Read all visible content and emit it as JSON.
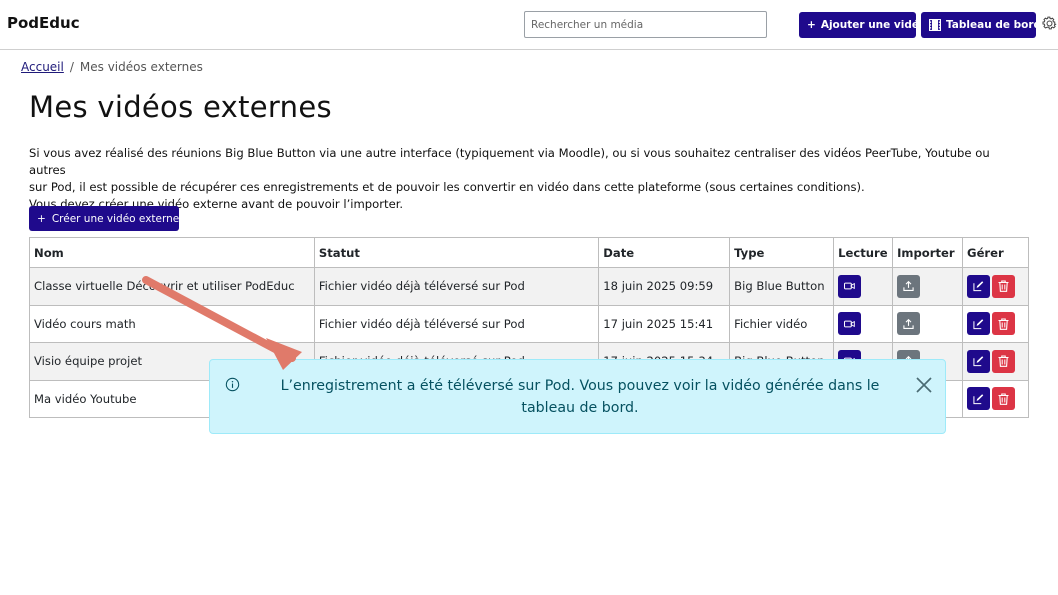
{
  "header": {
    "brand": "PodEduc",
    "search_placeholder": "Rechercher un média",
    "add_video_label": "Ajouter une vidéo",
    "dashboard_label": "Tableau de bord"
  },
  "breadcrumb": {
    "home": "Accueil",
    "separator": "/",
    "current": "Mes vidéos externes"
  },
  "page": {
    "title": "Mes vidéos externes",
    "intro_line1": "Si vous avez réalisé des réunions Big Blue Button via une autre interface (typiquement via Moodle), ou si vous souhaitez centraliser des vidéos PeerTube, Youtube ou autres",
    "intro_line2": "sur Pod, il est possible de récupérer ces enregistrements et de pouvoir les convertir en vidéo dans cette plateforme (sous certaines conditions).",
    "intro_line3": "Vous devez créer une vidéo externe avant de pouvoir l’importer.",
    "create_label": "Créer une vidéo externe"
  },
  "table": {
    "columns": [
      "Nom",
      "Statut",
      "Date",
      "Type",
      "Lecture",
      "Importer",
      "Gérer"
    ],
    "rows": [
      {
        "name": "Classe virtuelle Découvrir et utiliser PodEduc",
        "status": "Fichier vidéo déjà téléversé sur Pod",
        "date": "18 juin 2025 09:59",
        "type": "Big Blue Button"
      },
      {
        "name": "Vidéo cours math",
        "status": "Fichier vidéo déjà téléversé sur Pod",
        "date": "17 juin 2025 15:41",
        "type": "Fichier vidéo"
      },
      {
        "name": "Visio équipe projet",
        "status": "Fichier vidéo déjà téléversé sur Pod",
        "date": "17 juin 2025 15:34",
        "type": "Big Blue Button"
      },
      {
        "name": "Ma vidéo Youtube",
        "status": "",
        "date": "",
        "type": ""
      }
    ]
  },
  "toast": {
    "line1": "L’enregistrement a été téléversé sur Pod. Vous pouvez voir la vidéo générée dans le",
    "line2": "tableau de bord."
  },
  "colors": {
    "primary": "#1f0a8c",
    "danger": "#dc3545",
    "secondary": "#6c757d",
    "toast_bg": "#cff4fc",
    "arrow": "#e07a6a"
  }
}
